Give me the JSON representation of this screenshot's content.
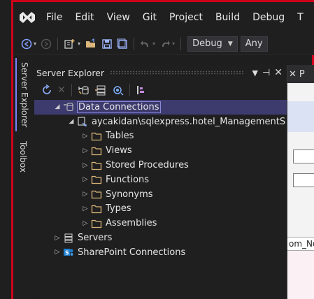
{
  "menubar": {
    "items": [
      "File",
      "Edit",
      "View",
      "Git",
      "Project",
      "Build",
      "Debug",
      "T"
    ]
  },
  "toolbar": {
    "config_value": "Debug",
    "platform_value": "Any"
  },
  "side_tabs": [
    "Server Explorer",
    "Toolbox"
  ],
  "panel": {
    "title": "Server Explorer"
  },
  "tree": {
    "data_connections": "Data Connections",
    "connection": "aycakidan\\sqlexpress.hotel_ManagementS",
    "folders": [
      "Tables",
      "Views",
      "Stored Procedures",
      "Functions",
      "Synonyms",
      "Types",
      "Assemblies"
    ],
    "servers": "Servers",
    "sharepoint": "SharePoint Connections"
  },
  "doc": {
    "tab_partial": "P",
    "grid_column": "om_No"
  },
  "colors": {
    "frame_border": "#d0021b",
    "selection": "#3d3a6e",
    "accent": "#7f7fff"
  }
}
